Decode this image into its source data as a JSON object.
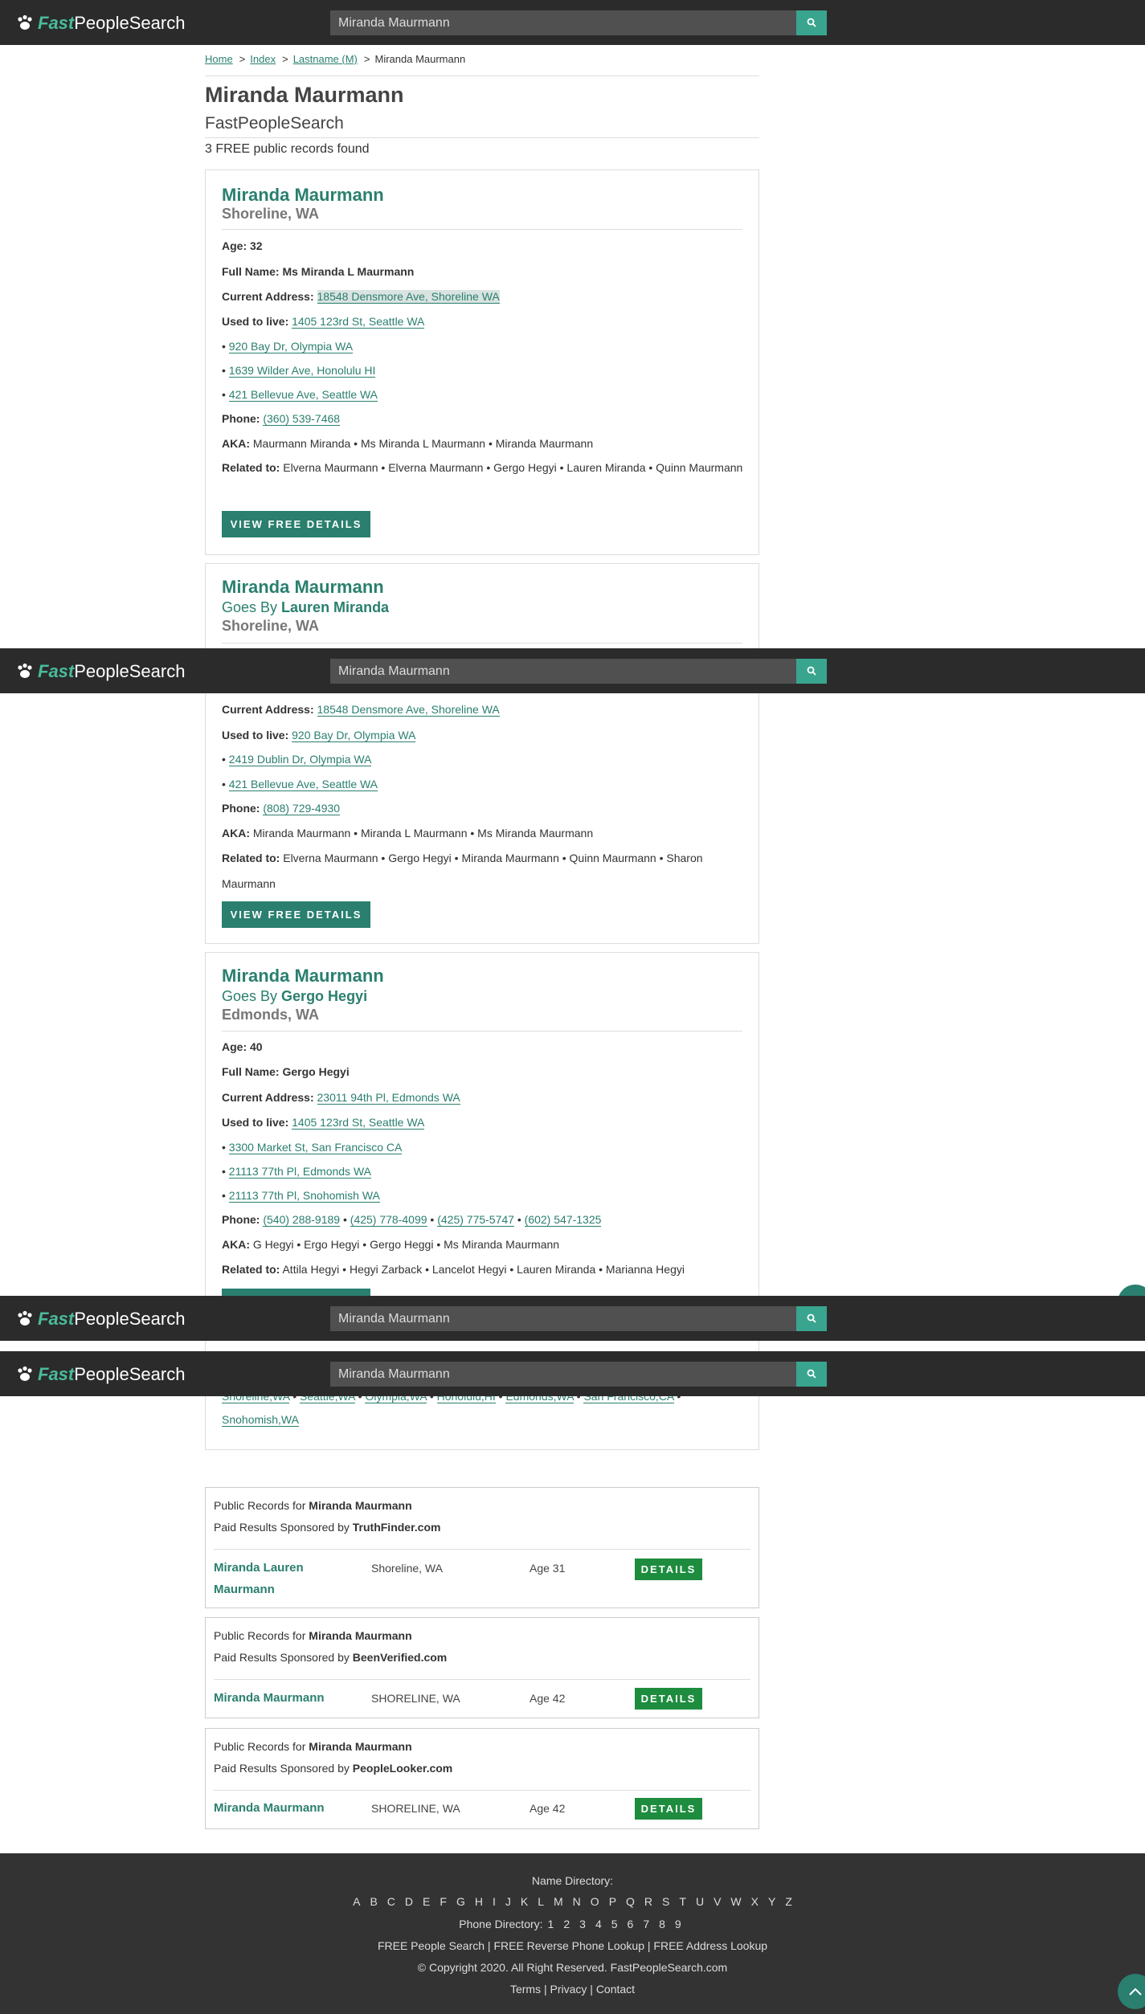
{
  "header": {
    "logo_fast": "Fast",
    "logo_rest": "PeopleSearch",
    "search_value": "Miranda Maurmann"
  },
  "breadcrumb": {
    "home": "Home",
    "index": "Index",
    "lastname": "Lastname (M)",
    "current": "Miranda Maurmann"
  },
  "page": {
    "title": "Miranda Maurmann",
    "subtitle": "FastPeopleSearch",
    "found": "3 FREE public records found"
  },
  "labels": {
    "age": "Age:",
    "full_name": "Full Name:",
    "current_address": "Current Address:",
    "used_to_live": "Used to live:",
    "phone": "Phone:",
    "aka": "AKA:",
    "related": "Related to:",
    "goes_by": "Goes By",
    "view_button": "VIEW FREE DETAILS",
    "bullet": "•"
  },
  "card1": {
    "name": "Miranda Maurmann",
    "location": "Shoreline, WA",
    "age": "32",
    "full_name": "Ms Miranda L Maurmann",
    "current_address": "18548 Densmore Ave, Shoreline WA",
    "used_to_live": "1405 123rd St, Seattle WA",
    "past": [
      "920 Bay Dr, Olympia WA",
      "1639 Wilder Ave, Honolulu HI",
      "421 Bellevue Ave, Seattle WA"
    ],
    "phone": "(360) 539-7468",
    "aka": "Maurmann Miranda • Ms Miranda L Maurmann • Miranda Maurmann",
    "related": "Elverna Maurmann • Elverna Maurmann • Gergo Hegyi • Lauren Miranda • Quinn Maurmann"
  },
  "card2": {
    "name": "Miranda Maurmann",
    "goes_by": "Lauren Miranda",
    "location": "Shoreline, WA",
    "current_address": "18548 Densmore Ave, Shoreline WA",
    "used_to_live": "920 Bay Dr, Olympia WA",
    "past": [
      "2419 Dublin Dr, Olympia WA",
      "421 Bellevue Ave, Seattle WA"
    ],
    "phone": "(808) 729-4930",
    "aka": "Miranda Maurmann • Miranda L Maurmann • Ms Miranda Maurmann",
    "related": "Elverna Maurmann • Gergo Hegyi • Miranda Maurmann • Quinn Maurmann • Sharon Maurmann"
  },
  "card3": {
    "name": "Miranda Maurmann",
    "goes_by": "Gergo Hegyi",
    "location": "Edmonds, WA",
    "age": "40",
    "full_name": "Gergo Hegyi",
    "current_address": "23011 94th Pl, Edmonds WA",
    "used_to_live": "1405 123rd St, Seattle WA",
    "past": [
      "3300 Market St, San Francisco CA",
      "21113 77th Pl, Edmonds WA",
      "21113 77th Pl, Snohomish WA"
    ],
    "phones": [
      "(540) 288-9189",
      "(425) 778-4099",
      "(425) 775-5747",
      "(602) 547-1325"
    ],
    "aka": "G Hegyi • Ergo Hegyi • Gergo Heggi • Ms Miranda Maurmann",
    "related": "Attila Hegyi • Hegyi Zarback • Lancelot Hegyi • Lauren Miranda • Marianna Hegyi"
  },
  "cities": {
    "row1": [
      "Shoreline,WA",
      "Seattle,WA",
      "Olympia,WA",
      "Honolulu,HI",
      "Edmonds,WA",
      "San Francisco,CA"
    ],
    "row2": "Snohomish,WA"
  },
  "sponsored": [
    {
      "prefix": "Public Records for",
      "name": "Miranda Maurmann",
      "sponsor_prefix": "Paid Results Sponsored by",
      "sponsor": "TruthFinder.com",
      "result_name": "Miranda Lauren Maurmann",
      "location": "Shoreline, WA",
      "age": "Age 31",
      "button": "DETAILS"
    },
    {
      "prefix": "Public Records for",
      "name": "Miranda Maurmann",
      "sponsor_prefix": "Paid Results Sponsored by",
      "sponsor": "BeenVerified.com",
      "result_name": "Miranda Maurmann",
      "location": "SHORELINE, WA",
      "age": "Age 42",
      "button": "DETAILS"
    },
    {
      "prefix": "Public Records for",
      "name": "Miranda Maurmann",
      "sponsor_prefix": "Paid Results Sponsored by",
      "sponsor": "PeopleLooker.com",
      "result_name": "Miranda Maurmann",
      "location": "SHORELINE, WA",
      "age": "Age 42",
      "button": "DETAILS"
    }
  ],
  "footer": {
    "name_directory": "Name Directory:",
    "letters": [
      "A",
      "B",
      "C",
      "D",
      "E",
      "F",
      "G",
      "H",
      "I",
      "J",
      "K",
      "L",
      "M",
      "N",
      "O",
      "P",
      "Q",
      "R",
      "S",
      "T",
      "U",
      "V",
      "W",
      "X",
      "Y",
      "Z"
    ],
    "phone_directory": "Phone Directory:",
    "digits": [
      "1",
      "2",
      "3",
      "4",
      "5",
      "6",
      "7",
      "8",
      "9"
    ],
    "links": "FREE People Search | FREE Reverse Phone Lookup | FREE Address Lookup",
    "copyright": "© Copyright 2020. All Right Reserved. FastPeopleSearch.com",
    "terms": "Terms",
    "privacy": "Privacy",
    "contact": "Contact",
    "sep": "|"
  },
  "colors": {
    "accent": "#2a7f6f",
    "header_bg": "#2b2b2b",
    "search_button": "#3aa58e",
    "details_button": "#1e8c3f",
    "footer_bg": "#333333"
  }
}
